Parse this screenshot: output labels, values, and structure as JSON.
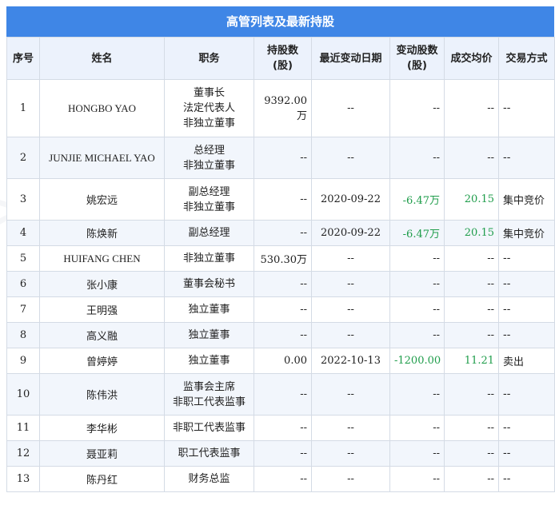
{
  "title": "高管列表及最新持股",
  "headers": {
    "no": "序号",
    "name": "姓名",
    "position": "职务",
    "holding": "持股数(股)",
    "date": "最近变动日期",
    "change": "变动股数(股)",
    "price": "成交均价",
    "type": "交易方式"
  },
  "rows": [
    {
      "no": "1",
      "name": "HONGBO YAO",
      "positions": [
        "董事长",
        "法定代表人",
        "非独立董事"
      ],
      "holding": "9392.00万",
      "date": "--",
      "change": "--",
      "price": "--",
      "type": "--"
    },
    {
      "no": "2",
      "name": "JUNJIE MICHAEL YAO",
      "positions": [
        "总经理",
        "非独立董事"
      ],
      "holding": "--",
      "date": "--",
      "change": "--",
      "price": "--",
      "type": "--"
    },
    {
      "no": "3",
      "name": "姚宏远",
      "positions": [
        "副总经理",
        "非独立董事"
      ],
      "holding": "--",
      "date": "2020-09-22",
      "change": "-6.47万",
      "price": "20.15",
      "type": "集中竞价"
    },
    {
      "no": "4",
      "name": "陈焕新",
      "positions": [
        "副总经理"
      ],
      "holding": "--",
      "date": "2020-09-22",
      "change": "-6.47万",
      "price": "20.15",
      "type": "集中竞价"
    },
    {
      "no": "5",
      "name": "HUIFANG CHEN",
      "positions": [
        "非独立董事"
      ],
      "holding": "530.30万",
      "date": "--",
      "change": "--",
      "price": "--",
      "type": "--"
    },
    {
      "no": "6",
      "name": "张小康",
      "positions": [
        "董事会秘书"
      ],
      "holding": "--",
      "date": "--",
      "change": "--",
      "price": "--",
      "type": "--"
    },
    {
      "no": "7",
      "name": "王明强",
      "positions": [
        "独立董事"
      ],
      "holding": "--",
      "date": "--",
      "change": "--",
      "price": "--",
      "type": "--"
    },
    {
      "no": "8",
      "name": "高义融",
      "positions": [
        "独立董事"
      ],
      "holding": "--",
      "date": "--",
      "change": "--",
      "price": "--",
      "type": "--"
    },
    {
      "no": "9",
      "name": "曾婷婷",
      "positions": [
        "独立董事"
      ],
      "holding": "0.00",
      "date": "2022-10-13",
      "change": "-1200.00",
      "price": "11.21",
      "type": "卖出"
    },
    {
      "no": "10",
      "name": "陈伟洪",
      "positions": [
        "监事会主席",
        "非职工代表监事"
      ],
      "holding": "--",
      "date": "--",
      "change": "--",
      "price": "--",
      "type": "--"
    },
    {
      "no": "11",
      "name": "李华彬",
      "positions": [
        "非职工代表监事"
      ],
      "holding": "--",
      "date": "--",
      "change": "--",
      "price": "--",
      "type": "--"
    },
    {
      "no": "12",
      "name": "聂亚莉",
      "positions": [
        "职工代表监事"
      ],
      "holding": "--",
      "date": "--",
      "change": "--",
      "price": "--",
      "type": "--"
    },
    {
      "no": "13",
      "name": "陈丹红",
      "positions": [
        "财务总监"
      ],
      "holding": "--",
      "date": "--",
      "change": "--",
      "price": "--",
      "type": "--"
    }
  ],
  "watermark": "证券之星",
  "colors": {
    "header_bar": "#3f86e6",
    "green": "#1f9d4b",
    "header_row": "#ecf2fc"
  }
}
